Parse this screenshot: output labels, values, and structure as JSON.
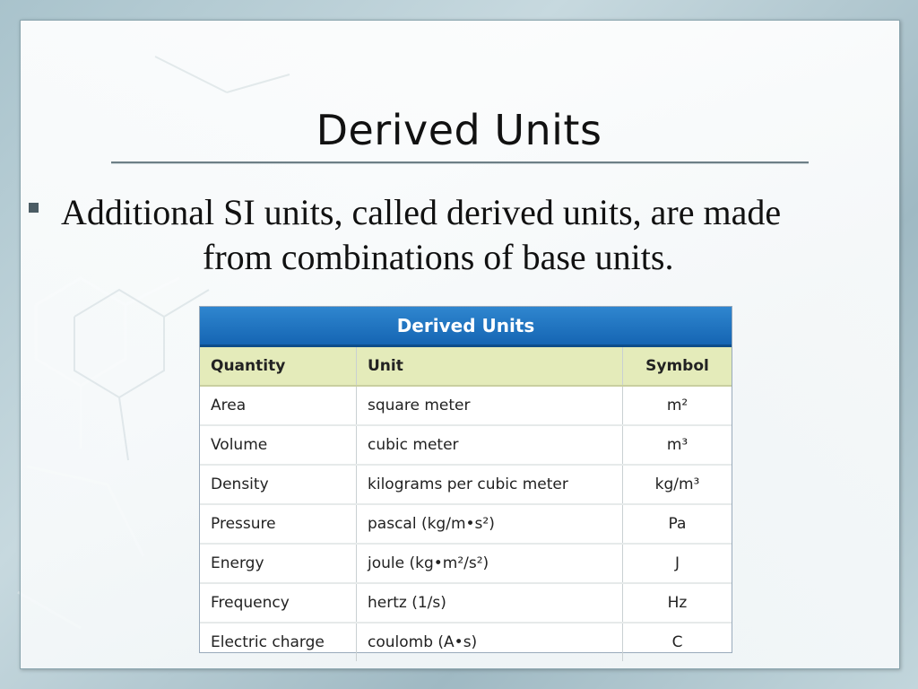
{
  "slide": {
    "title": "Derived Units",
    "bullet": {
      "line1": "Additional SI units, called derived units, are made",
      "line2": "from combinations of base units."
    }
  },
  "table": {
    "title": "Derived Units",
    "headers": [
      "Quantity",
      "Unit",
      "Symbol"
    ],
    "rows": [
      {
        "quantity": "Area",
        "unit": "square meter",
        "symbol": "m²"
      },
      {
        "quantity": "Volume",
        "unit": "cubic meter",
        "symbol": "m³"
      },
      {
        "quantity": "Density",
        "unit": "kilograms per cubic meter",
        "symbol": "kg/m³"
      },
      {
        "quantity": "Pressure",
        "unit": "pascal (kg/m•s²)",
        "symbol": "Pa"
      },
      {
        "quantity": "Energy",
        "unit": "joule (kg•m²/s²)",
        "symbol": "J"
      },
      {
        "quantity": "Frequency",
        "unit": "hertz (1/s)",
        "symbol": "Hz"
      },
      {
        "quantity": "Electric charge",
        "unit": "coulomb (A•s)",
        "symbol": "C"
      }
    ]
  },
  "colors": {
    "table_header": "#1a6fbe",
    "column_header": "#e4ebba",
    "background": "#b4cbd2"
  }
}
